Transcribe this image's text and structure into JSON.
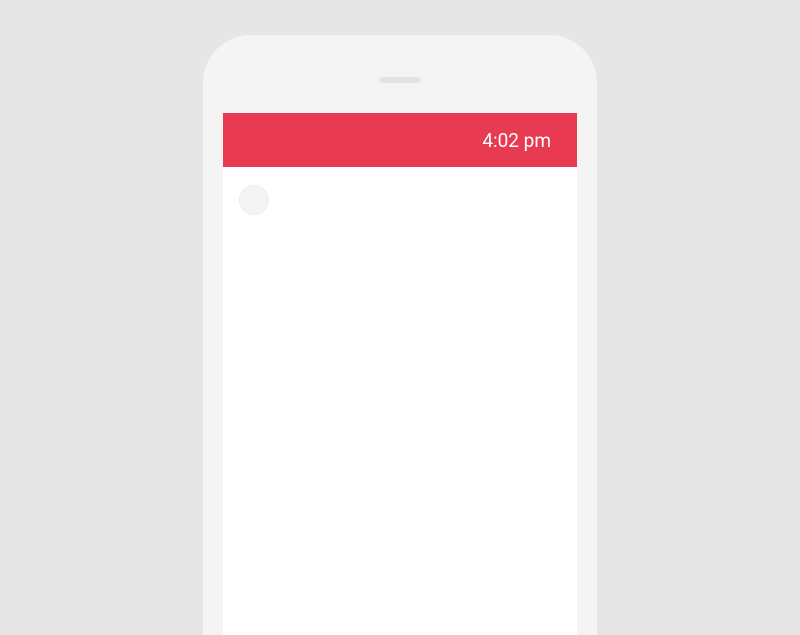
{
  "statusBar": {
    "time": "4:02 pm"
  },
  "colors": {
    "accent": "#e83a51",
    "background": "#e6e6e6",
    "phoneFrame": "#f4f4f4"
  }
}
